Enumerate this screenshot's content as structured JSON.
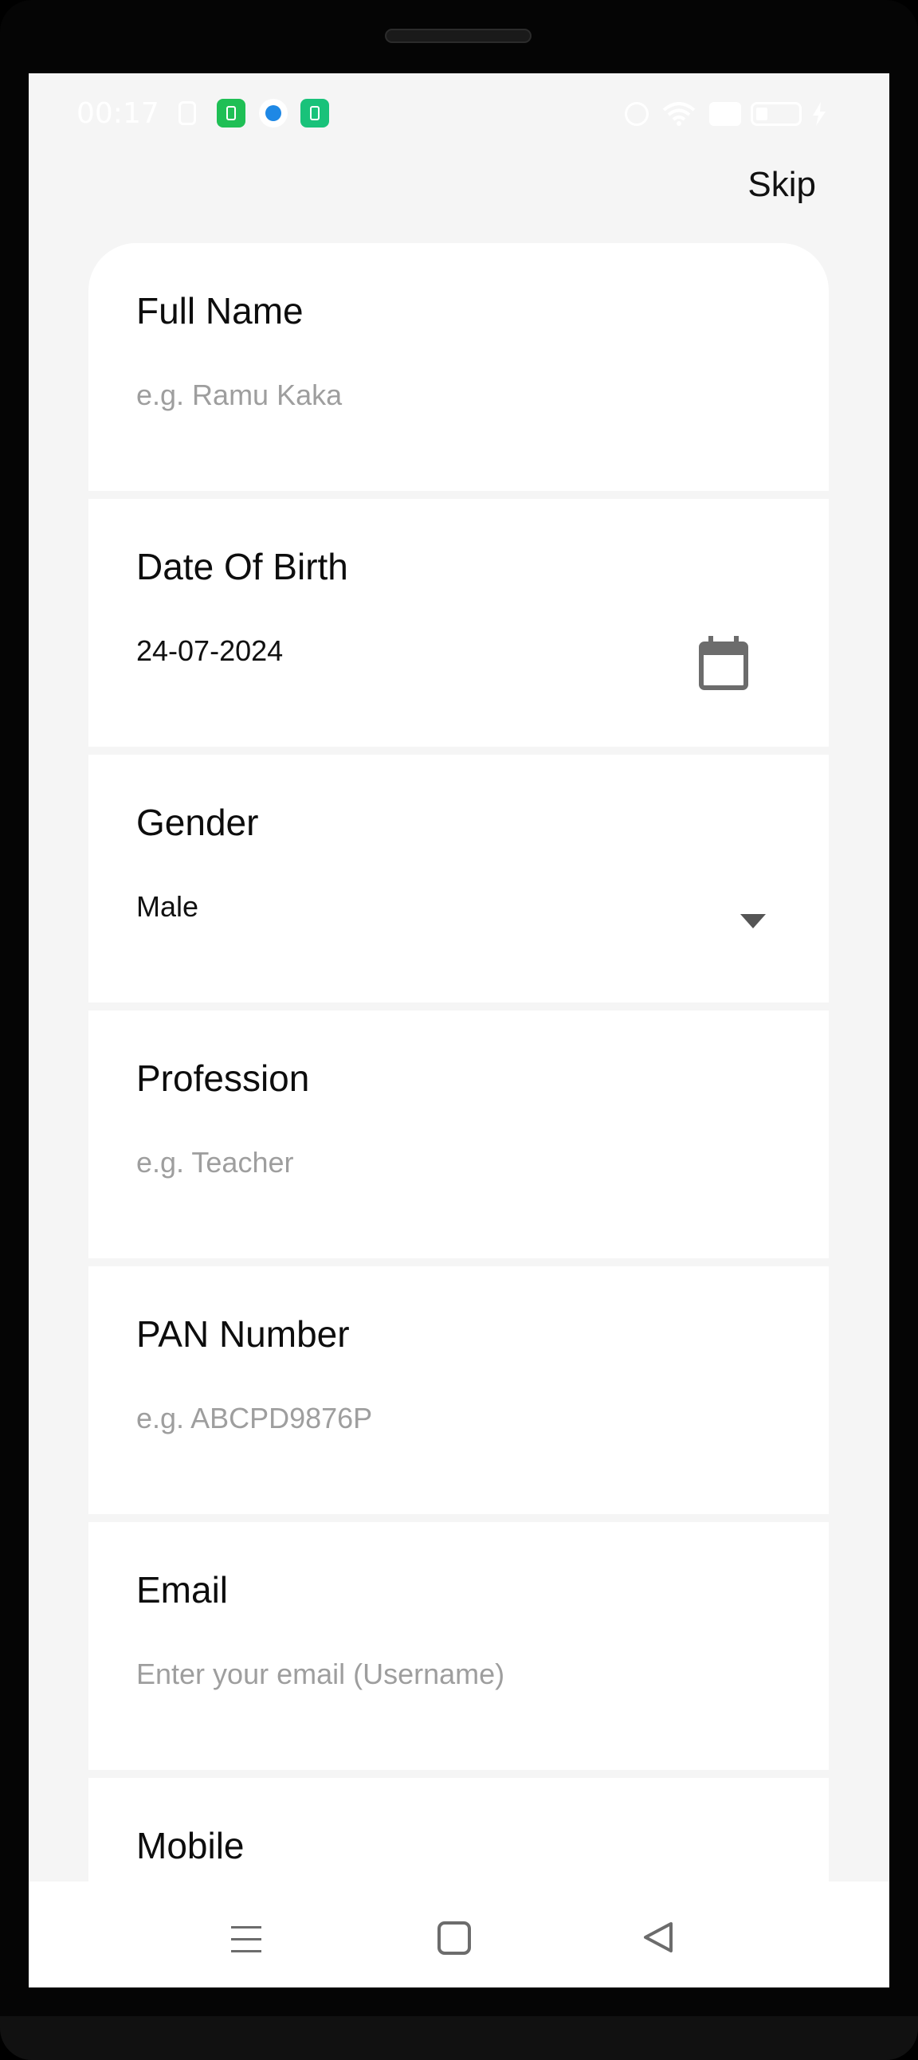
{
  "status_bar": {
    "time": "00:17"
  },
  "header": {
    "skip_label": "Skip"
  },
  "form": {
    "full_name": {
      "label": "Full Name",
      "placeholder": "e.g. Ramu Kaka"
    },
    "date_of_birth": {
      "label": "Date Of Birth",
      "value": "24-07-2024"
    },
    "gender": {
      "label": "Gender",
      "value": "Male"
    },
    "profession": {
      "label": "Profession",
      "placeholder": "e.g. Teacher"
    },
    "pan_number": {
      "label": "PAN Number",
      "placeholder": "e.g. ABCPD9876P"
    },
    "email": {
      "label": "Email",
      "placeholder": "Enter your email (Username)"
    },
    "mobile": {
      "label": "Mobile"
    }
  },
  "icons": {
    "date_picker": "calendar-icon",
    "gender_dropdown": "caret-down-icon",
    "nav_menu": "menu-icon",
    "nav_home": "home-icon",
    "nav_back": "back-icon"
  },
  "colors": {
    "background": "#f5f5f5",
    "card": "#ffffff",
    "placeholder": "#9e9e9e",
    "icon": "#6c6c6c"
  }
}
